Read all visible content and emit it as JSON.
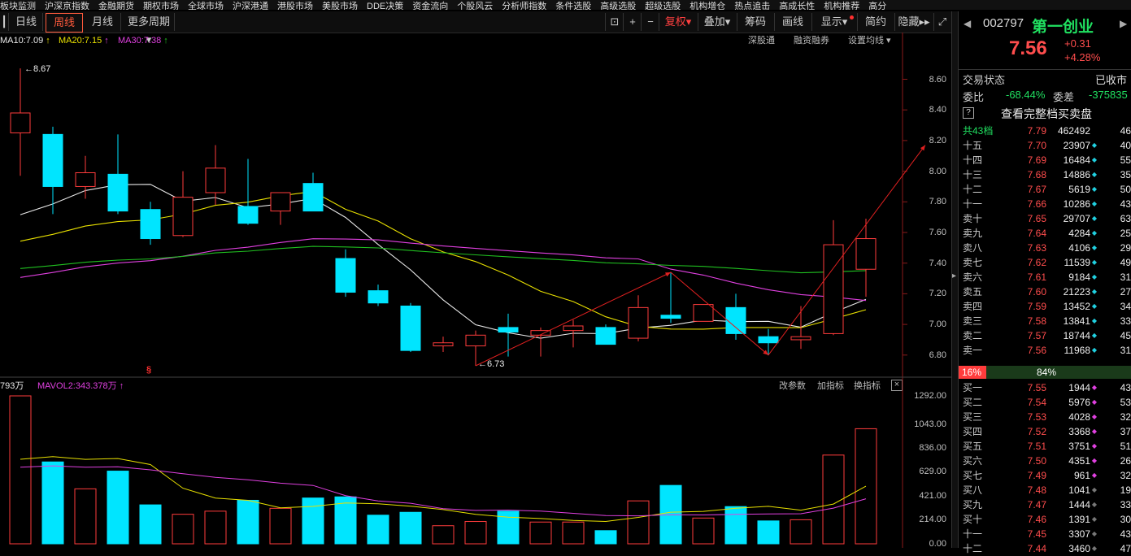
{
  "top_menu": [
    "板块监测",
    "沪深京指数",
    "金融期货",
    "期权市场",
    "全球市场",
    "沪深港通",
    "港股市场",
    "美股市场",
    "DDE决策",
    "资金流向",
    "个股风云",
    "分析师指数",
    "条件选股",
    "高级选股",
    "超级选股",
    "机构增仓",
    "热点追击",
    "高成长性",
    "机构推荐",
    "高分"
  ],
  "toolbar": {
    "tabs": [
      "日线",
      "周线",
      "月线",
      "更多周期"
    ],
    "active_tab": "周线",
    "markets": [
      "期权市场",
      "全球市场",
      "沪深港通",
      "港股市场",
      "美股市场",
      "DDE决策",
      "资金流向",
      "个股风云",
      "分析师指数",
      "条件选股",
      "高级选股",
      "超级选股",
      "机构增仓",
      "热点追击",
      "高成长性",
      "机构推荐",
      "高分"
    ],
    "buttons": [
      "复权",
      "叠加",
      "筹码",
      "画线",
      "显示",
      "简约",
      "隐藏"
    ],
    "fuquan": "复权"
  },
  "ma_legend": {
    "ma10": "MA10:7.09",
    "ma20": "MA20:7.15",
    "ma30": "MA30:7.38",
    "right_links": [
      "深股通",
      "融资融券",
      "设置均线"
    ]
  },
  "price_axis": [
    "8.60",
    "8.40",
    "8.20",
    "8.00",
    "7.80",
    "7.60",
    "7.40",
    "7.20",
    "7.00",
    "6.80"
  ],
  "annotations": {
    "high": "8.67",
    "low": "6.73",
    "marker": "§"
  },
  "vol_legend": {
    "vol": "793万",
    "mavol2": "MAVOL2:343.378万",
    "links": [
      "改参数",
      "加指标",
      "换指标"
    ]
  },
  "vol_axis": [
    "1292.00",
    "1043.00",
    "836.00",
    "629.00",
    "421.00",
    "214.00",
    "0.00"
  ],
  "chart_data": {
    "type": "candlestick",
    "candles": [
      {
        "o": 8.25,
        "h": 8.67,
        "l": 7.97,
        "c": 8.38
      },
      {
        "o": 8.24,
        "h": 8.29,
        "l": 7.72,
        "c": 7.9
      },
      {
        "o": 7.9,
        "h": 8.1,
        "l": 7.82,
        "c": 7.99
      },
      {
        "o": 7.98,
        "h": 8.24,
        "l": 7.72,
        "c": 7.74
      },
      {
        "o": 7.75,
        "h": 7.8,
        "l": 7.52,
        "c": 7.56
      },
      {
        "o": 7.58,
        "h": 8.0,
        "l": 7.57,
        "c": 7.83
      },
      {
        "o": 7.86,
        "h": 8.17,
        "l": 7.78,
        "c": 8.02
      },
      {
        "o": 7.77,
        "h": 8.08,
        "l": 7.65,
        "c": 7.66
      },
      {
        "o": 7.74,
        "h": 7.82,
        "l": 7.65,
        "c": 7.86
      },
      {
        "o": 7.92,
        "h": 7.99,
        "l": 7.74,
        "c": 7.74
      },
      {
        "o": 7.43,
        "h": 7.49,
        "l": 7.18,
        "c": 7.21
      },
      {
        "o": 7.22,
        "h": 7.26,
        "l": 7.12,
        "c": 7.14
      },
      {
        "o": 7.12,
        "h": 7.14,
        "l": 6.82,
        "c": 6.83
      },
      {
        "o": 6.86,
        "h": 6.92,
        "l": 6.82,
        "c": 6.88
      },
      {
        "o": 6.86,
        "h": 6.96,
        "l": 6.73,
        "c": 6.93
      },
      {
        "o": 6.98,
        "h": 7.07,
        "l": 6.79,
        "c": 6.95
      },
      {
        "o": 6.93,
        "h": 6.98,
        "l": 6.79,
        "c": 6.96
      },
      {
        "o": 6.96,
        "h": 7.03,
        "l": 6.85,
        "c": 6.99
      },
      {
        "o": 6.98,
        "h": 7.0,
        "l": 6.87,
        "c": 6.87
      },
      {
        "o": 6.91,
        "h": 7.19,
        "l": 6.89,
        "c": 7.11
      },
      {
        "o": 7.06,
        "h": 7.34,
        "l": 7.01,
        "c": 7.04
      },
      {
        "o": 7.02,
        "h": 7.13,
        "l": 7.02,
        "c": 7.13
      },
      {
        "o": 7.11,
        "h": 7.2,
        "l": 6.9,
        "c": 6.94
      },
      {
        "o": 6.92,
        "h": 6.97,
        "l": 6.8,
        "c": 6.88
      },
      {
        "o": 6.9,
        "h": 7.12,
        "l": 6.84,
        "c": 6.92
      },
      {
        "o": 6.94,
        "h": 7.68,
        "l": 6.93,
        "c": 7.52
      },
      {
        "o": 7.36,
        "h": 7.69,
        "l": 7.18,
        "c": 7.56
      }
    ],
    "volume": [
      1292,
      715,
      480,
      635,
      340,
      258,
      285,
      380,
      310,
      400,
      410,
      250,
      275,
      158,
      195,
      285,
      190,
      190,
      115,
      375,
      510,
      225,
      325,
      200,
      210,
      775,
      1005
    ],
    "vol_ylim": [
      0,
      1292
    ],
    "price_ylim": [
      6.73,
      8.67
    ]
  },
  "quote": {
    "code": "002797",
    "name": "第一创业",
    "price": "7.56",
    "change": "+0.31",
    "change_pct": "+4.28%",
    "status_label": "交易状态",
    "status": "已收市",
    "weibi_label": "委比",
    "weibi": "-68.44%",
    "weicha_label": "委差",
    "weicha": "-375835",
    "full_book": "查看完整档买卖盘",
    "total_row": {
      "label": "共43档",
      "price": "7.79",
      "vol": "462492",
      "cnt": "46"
    },
    "ratio_left": "16%",
    "ratio_right": "84%"
  },
  "asks": [
    {
      "label": "十五",
      "price": "7.70",
      "vol": "23907",
      "cnt": "40"
    },
    {
      "label": "十四",
      "price": "7.69",
      "vol": "16484",
      "cnt": "55"
    },
    {
      "label": "十三",
      "price": "7.68",
      "vol": "14886",
      "cnt": "35"
    },
    {
      "label": "十二",
      "price": "7.67",
      "vol": "5619",
      "cnt": "50"
    },
    {
      "label": "十一",
      "price": "7.66",
      "vol": "10286",
      "cnt": "43"
    },
    {
      "label": "卖十",
      "price": "7.65",
      "vol": "29707",
      "cnt": "63"
    },
    {
      "label": "卖九",
      "price": "7.64",
      "vol": "4284",
      "cnt": "25"
    },
    {
      "label": "卖八",
      "price": "7.63",
      "vol": "4106",
      "cnt": "29"
    },
    {
      "label": "卖七",
      "price": "7.62",
      "vol": "11539",
      "cnt": "49"
    },
    {
      "label": "卖六",
      "price": "7.61",
      "vol": "9184",
      "cnt": "31"
    },
    {
      "label": "卖五",
      "price": "7.60",
      "vol": "21223",
      "cnt": "27"
    },
    {
      "label": "卖四",
      "price": "7.59",
      "vol": "13452",
      "cnt": "34"
    },
    {
      "label": "卖三",
      "price": "7.58",
      "vol": "13841",
      "cnt": "33"
    },
    {
      "label": "卖二",
      "price": "7.57",
      "vol": "18744",
      "cnt": "45"
    },
    {
      "label": "卖一",
      "price": "7.56",
      "vol": "11968",
      "cnt": "31"
    }
  ],
  "bids": [
    {
      "label": "买一",
      "price": "7.55",
      "vol": "1944",
      "cnt": "43"
    },
    {
      "label": "买二",
      "price": "7.54",
      "vol": "5976",
      "cnt": "53"
    },
    {
      "label": "买三",
      "price": "7.53",
      "vol": "4028",
      "cnt": "32"
    },
    {
      "label": "买四",
      "price": "7.52",
      "vol": "3368",
      "cnt": "37"
    },
    {
      "label": "买五",
      "price": "7.51",
      "vol": "3751",
      "cnt": "51"
    },
    {
      "label": "买六",
      "price": "7.50",
      "vol": "4351",
      "cnt": "26"
    },
    {
      "label": "买七",
      "price": "7.49",
      "vol": "961",
      "cnt": "32"
    },
    {
      "label": "买八",
      "price": "7.48",
      "vol": "1041",
      "cnt": "19"
    },
    {
      "label": "买九",
      "price": "7.47",
      "vol": "1444",
      "cnt": "33"
    },
    {
      "label": "买十",
      "price": "7.46",
      "vol": "1391",
      "cnt": "30"
    },
    {
      "label": "十一",
      "price": "7.45",
      "vol": "3307",
      "cnt": "43"
    },
    {
      "label": "十二",
      "price": "7.44",
      "vol": "3460",
      "cnt": "47"
    }
  ],
  "colors": {
    "up": "#ff3c3c",
    "down": "#00e5ff",
    "ma_white": "#e8e8e8",
    "ma_yellow": "#e8e000",
    "ma_magenta": "#e040e0",
    "ma_green": "#20c020"
  }
}
